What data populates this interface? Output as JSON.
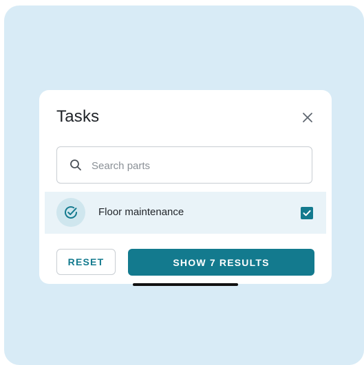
{
  "dialog": {
    "title": "Tasks",
    "close_icon": "close-icon"
  },
  "search": {
    "placeholder": "Search parts",
    "value": "",
    "icon": "search-icon"
  },
  "tasks": [
    {
      "label": "Floor maintenance",
      "icon": "check-circle-icon",
      "checked": true
    }
  ],
  "actions": {
    "reset_label": "RESET",
    "show_label": "SHOW 7 RESULTS"
  },
  "colors": {
    "accent": "#137a8e",
    "backdrop": "#d8ebf6",
    "row_highlight": "#e9f3f8"
  }
}
